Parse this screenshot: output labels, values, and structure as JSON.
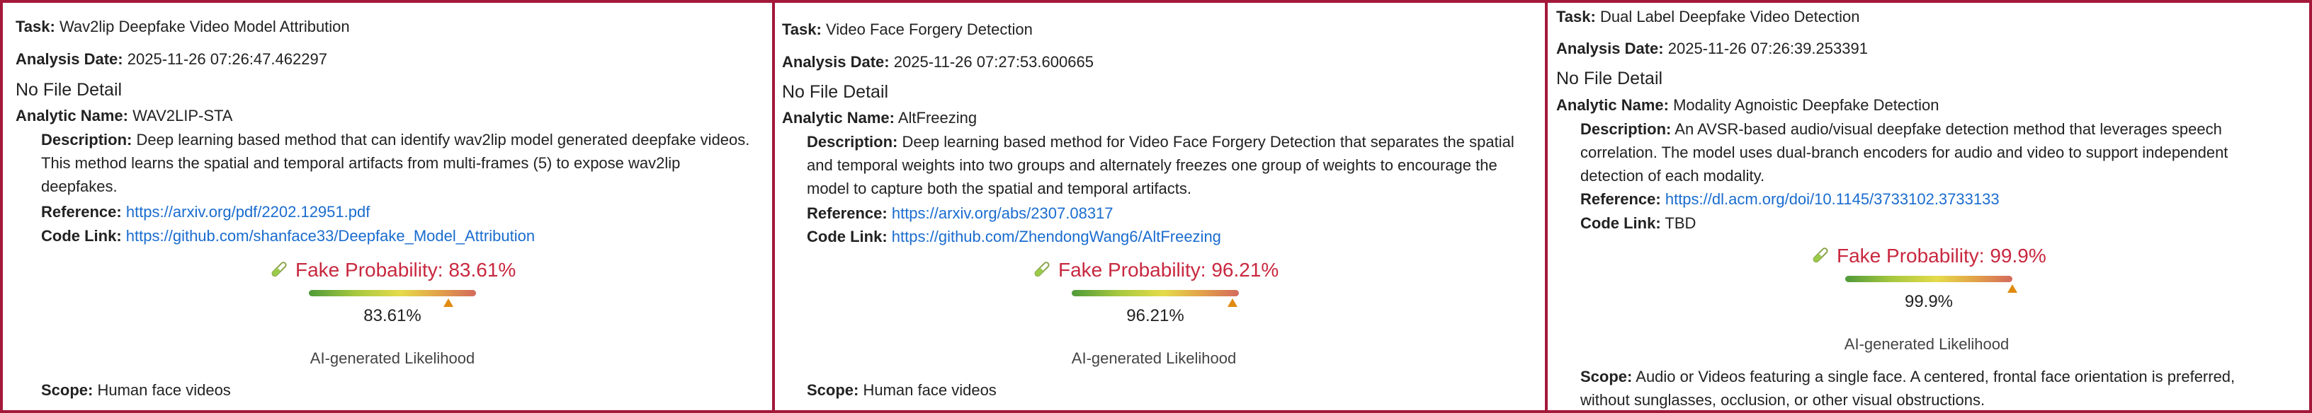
{
  "labels": {
    "task": "Task:",
    "analysis_date": "Analysis Date:",
    "analytic_name": "Analytic Name:",
    "description": "Description:",
    "reference": "Reference:",
    "code_link": "Code Link:",
    "scope": "Scope:"
  },
  "panels": [
    {
      "task": "Wav2lip Deepfake Video Model Attribution",
      "analysis_date": "2025-11-26 07:26:47.462297",
      "no_file_detail": "No File Detail",
      "analytic_name": "WAV2LIP-STA",
      "description_lines": [
        "Deep learning based method that can identify wav2lip model generated deepfake videos.",
        "This method learns the spatial and temporal artifacts from multi-frames (5) to expose wav2lip",
        "deepfakes."
      ],
      "reference": "https://arxiv.org/pdf/2202.12951.pdf",
      "code_link": "https://github.com/shanface33/Deepfake_Model_Attribution",
      "fake_probability_label": "Fake Probability: 83.61%",
      "probability": 0.8361,
      "probability_text": "83.61%",
      "likelihood_label": "AI-generated Likelihood",
      "scope": "Human face videos"
    },
    {
      "task": "Video Face Forgery Detection",
      "analysis_date": "2025-11-26 07:27:53.600665",
      "no_file_detail": "No File Detail",
      "analytic_name": "AltFreezing",
      "description_lines": [
        "Deep learning based method for Video Face Forgery Detection that separates the spatial",
        "and temporal weights into two groups and alternately freezes one group of weights to encourage the",
        "model to capture both the spatial and temporal artifacts."
      ],
      "reference": "https://arxiv.org/abs/2307.08317",
      "code_link": "https://github.com/ZhendongWang6/AltFreezing",
      "fake_probability_label": "Fake Probability: 96.21%",
      "probability": 0.9621,
      "probability_text": "96.21%",
      "likelihood_label": "AI-generated Likelihood",
      "scope": "Human face videos"
    },
    {
      "task": "Dual Label Deepfake Video Detection",
      "analysis_date": "2025-11-26 07:26:39.253391",
      "no_file_detail": "No File Detail",
      "analytic_name": "Modality Agnoistic Deepfake Detection",
      "description_lines": [
        "An AVSR-based audio/visual deepfake detection method that leverages speech",
        "correlation. The model uses dual-branch encoders for audio and video to support independent",
        "detection of each modality."
      ],
      "reference": "https://dl.acm.org/doi/10.1145/3733102.3733133",
      "code_link": "TBD",
      "fake_probability_label": "Fake Probability: 99.9%",
      "probability": 0.999,
      "probability_text": "99.9%",
      "likelihood_label": "AI-generated Likelihood",
      "scope_lines": [
        "Audio or Videos featuring a single face. A centered, frontal face orientation is preferred,",
        "without sunglasses, occlusion, or other visual obstructions."
      ]
    }
  ],
  "colors": {
    "border": "#a3193a",
    "probability": "#c8283f",
    "link": "#1a6ccf",
    "marker": "#e08b10"
  }
}
